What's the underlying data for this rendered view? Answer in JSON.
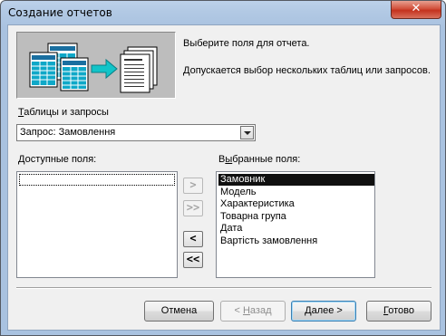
{
  "window": {
    "title": "Создание отчетов",
    "close_symbol": "✕"
  },
  "banner": {
    "hint1": "Выберите поля для отчета.",
    "hint2": "Допускается выбор нескольких таблиц или запросов."
  },
  "source": {
    "label_underlined": "Т",
    "label_rest": "аблицы и запросы",
    "selected": "Запрос: Замовлення"
  },
  "available": {
    "label_underlined": "Д",
    "label_rest": "оступные поля:",
    "items": []
  },
  "selected_fields": {
    "label_pre": "В",
    "label_underlined": "ы",
    "label_rest": "бранные поля:",
    "items": [
      "Замовник",
      "Модель",
      "Характеристика",
      "Товарна група",
      "Дата",
      "Вартість замовлення"
    ],
    "active_index": 0
  },
  "move_buttons": {
    "add": ">",
    "add_all": ">>",
    "remove": "<",
    "remove_all": "<<"
  },
  "buttons": {
    "cancel": "Отмена",
    "back_pre": "< ",
    "back_u": "Н",
    "back_rest": "азад",
    "next_u": "Д",
    "next_rest": "алее >",
    "finish_u": "Г",
    "finish_rest": "отово"
  }
}
